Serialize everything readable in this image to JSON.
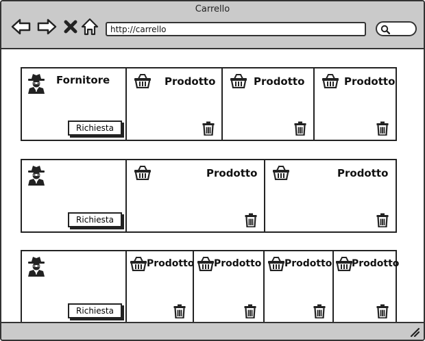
{
  "window": {
    "title": "Carrello"
  },
  "browser": {
    "url": "http://carrello"
  },
  "icons": {
    "back": "arrow-left-icon",
    "forward": "arrow-right-icon",
    "stop": "close-icon",
    "home": "home-icon",
    "search": "search-icon",
    "supplier": "spy-user-icon",
    "product": "basket-icon",
    "remove": "trash-icon",
    "resize": "resize-grip-icon"
  },
  "rows": [
    {
      "supplier": {
        "label": "Fornitore",
        "button": "Richiesta"
      },
      "products": [
        {
          "label": "Prodotto"
        },
        {
          "label": "Prodotto"
        },
        {
          "label": "Prodotto"
        }
      ]
    },
    {
      "supplier": {
        "label": "",
        "button": "Richiesta"
      },
      "products": [
        {
          "label": "Prodotto"
        },
        {
          "label": "Prodotto"
        }
      ]
    },
    {
      "supplier": {
        "label": "",
        "button": "Richiesta"
      },
      "products": [
        {
          "label": "Prodotto"
        },
        {
          "label": "Prodotto"
        },
        {
          "label": "Prodotto"
        },
        {
          "label": "Prodotto"
        }
      ]
    }
  ]
}
